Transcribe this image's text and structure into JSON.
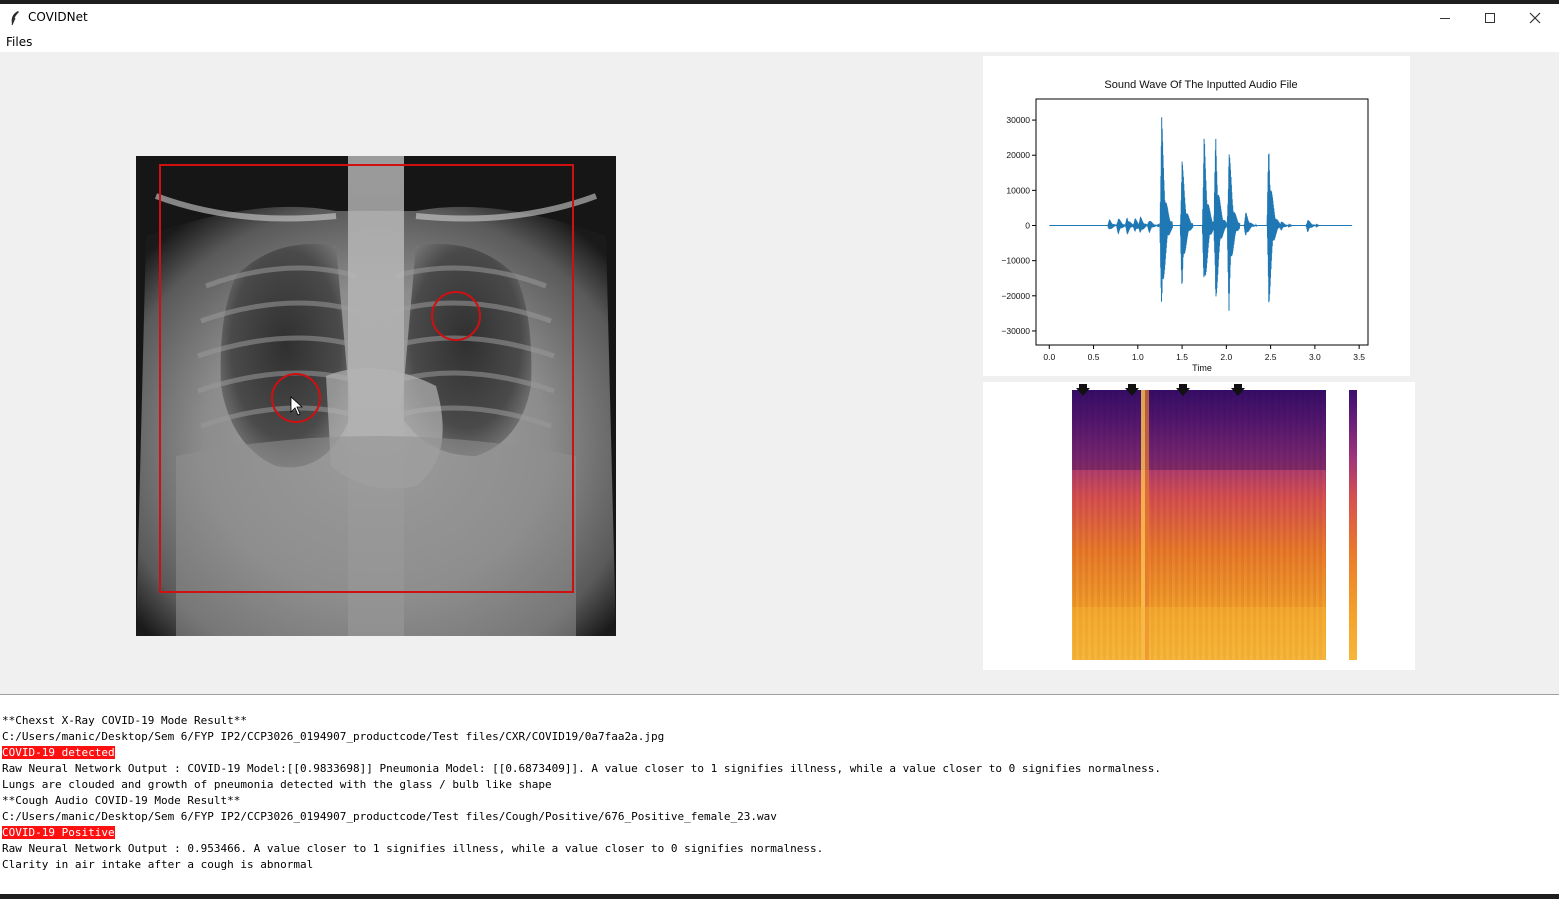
{
  "window": {
    "title": "COVIDNet"
  },
  "menubar": {
    "files_label": "Files"
  },
  "wave_chart": {
    "chart_data": {
      "type": "line",
      "title": "Sound Wave Of The Inputted Audio File",
      "xlabel": "Time",
      "ylabel": "",
      "xlim": [
        -0.15,
        3.6
      ],
      "ylim": [
        -34000,
        36000
      ],
      "x_ticks": [
        "0.0",
        "0.5",
        "1.0",
        "1.5",
        "2.0",
        "2.5",
        "3.0",
        "3.5"
      ],
      "y_ticks": [
        "30000",
        "20000",
        "10000",
        "0",
        "−10000",
        "−20000",
        "−30000"
      ],
      "series": [
        {
          "color": "#1f77b4",
          "bursts": [
            {
              "t": 0.68,
              "amp": 1800
            },
            {
              "t": 0.78,
              "amp": 2500
            },
            {
              "t": 0.88,
              "amp": 2600
            },
            {
              "t": 0.97,
              "amp": 2000
            },
            {
              "t": 1.03,
              "amp": 2300
            },
            {
              "t": 1.13,
              "amp": 2000
            },
            {
              "t": 1.27,
              "amp": 32000
            },
            {
              "t": 1.5,
              "amp": 21000
            },
            {
              "t": 1.75,
              "amp": 26000
            },
            {
              "t": 1.88,
              "amp": 27000
            },
            {
              "t": 2.03,
              "amp": 26000
            },
            {
              "t": 2.22,
              "amp": 4000
            },
            {
              "t": 2.48,
              "amp": 26000
            },
            {
              "t": 2.62,
              "amp": 1500
            },
            {
              "t": 2.92,
              "amp": 2000
            }
          ],
          "time_range": [
            0.0,
            3.42
          ]
        }
      ]
    }
  },
  "spectrogram": {
    "markers": [
      "down-arrow-icon",
      "down-arrow-icon",
      "down-arrow-icon",
      "down-arrow-icon"
    ]
  },
  "console": {
    "lines": [
      {
        "text": "**Chexst X-Ray COVID-19 Mode Result**",
        "highlight": false
      },
      {
        "text": "C:/Users/manic/Desktop/Sem 6/FYP IP2/CCP3026_0194907_productcode/Test files/CXR/COVID19/0a7faa2a.jpg",
        "highlight": false
      },
      {
        "text": "COVID-19 detected",
        "highlight": true
      },
      {
        "text": "Raw Neural Network Output : COVID-19 Model:[[0.9833698]] Pneumonia Model: [[0.6873409]]. A value closer to 1 signifies illness, while a value closer to 0 signifies normalness.",
        "highlight": false
      },
      {
        "text": "Lungs are clouded and growth of pneumonia detected with the glass / bulb like shape",
        "highlight": false
      },
      {
        "text": "**Cough Audio COVID-19 Mode Result**",
        "highlight": false
      },
      {
        "text": "C:/Users/manic/Desktop/Sem 6/FYP IP2/CCP3026_0194907_productcode/Test files/Cough/Positive/676_Positive_female_23.wav",
        "highlight": false
      },
      {
        "text": "COVID-19 Positive",
        "highlight": true
      },
      {
        "text": "Raw Neural Network Output : 0.953466. A value closer to 1 signifies illness, while a value closer to 0 signifies normalness.",
        "highlight": false
      },
      {
        "text": "Clarity in air intake after a cough is abnormal",
        "highlight": false
      }
    ]
  }
}
